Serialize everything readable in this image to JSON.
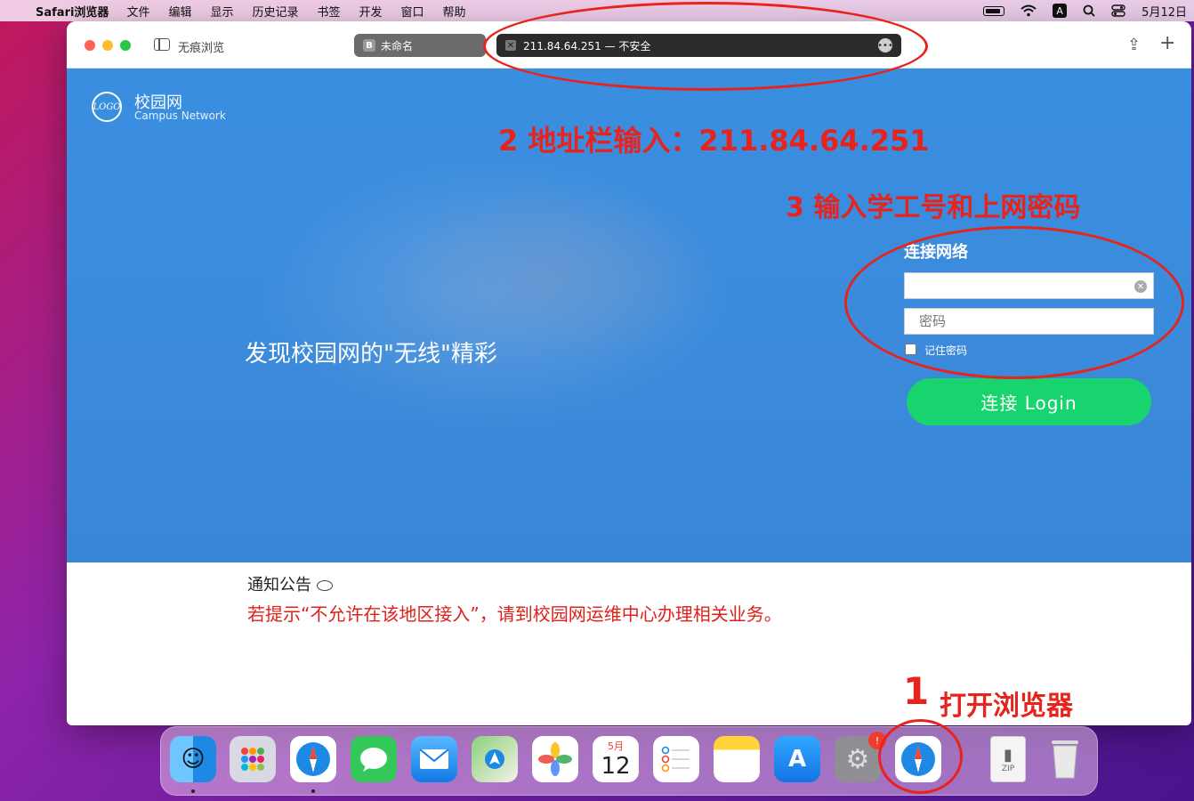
{
  "menubar": {
    "app_name": "Safari浏览器",
    "items": [
      "文件",
      "编辑",
      "显示",
      "历史记录",
      "书签",
      "开发",
      "窗口",
      "帮助"
    ],
    "ime": "A",
    "date": "5月12日"
  },
  "browser": {
    "private_label": "无痕浏览",
    "tab_inactive": {
      "favicon": "B",
      "title": "未命名"
    },
    "tab_active": {
      "url": "211.84.64.251 — 不安全"
    }
  },
  "page": {
    "logo_mark": "LOGO",
    "logo_title": "校园网",
    "logo_subtitle": "Campus Network",
    "slogan": "发现校园网的\"无线\"精彩",
    "login": {
      "title": "连接网络",
      "username_value": "",
      "password_placeholder": "密码",
      "remember_label": "记住密码",
      "button_label": "连接 Login"
    },
    "notice": {
      "title": "通知公告",
      "text": "若提示“不允许在该地区接入”，请到校园网运维中心办理相关业务。"
    }
  },
  "annotations": {
    "step2": "2 地址栏输入：211.84.64.251",
    "step3": "3 输入学工号和上网密码",
    "step1_num": "1",
    "step1_text": "打开浏览器",
    "color": "#e8231c"
  },
  "dock": {
    "items": [
      "finder-icon",
      "launchpad-icon",
      "safari-icon",
      "messages-icon",
      "mail-icon",
      "maps-icon",
      "photos-icon",
      "calendar-icon",
      "reminders-icon",
      "notes-icon",
      "app-store-icon",
      "system-preferences-icon",
      "safari-icon",
      "zip-archive-icon",
      "trash-icon"
    ],
    "calendar_month": "5月",
    "calendar_day": "12",
    "zip_label": "ZIP",
    "badge": "!"
  }
}
